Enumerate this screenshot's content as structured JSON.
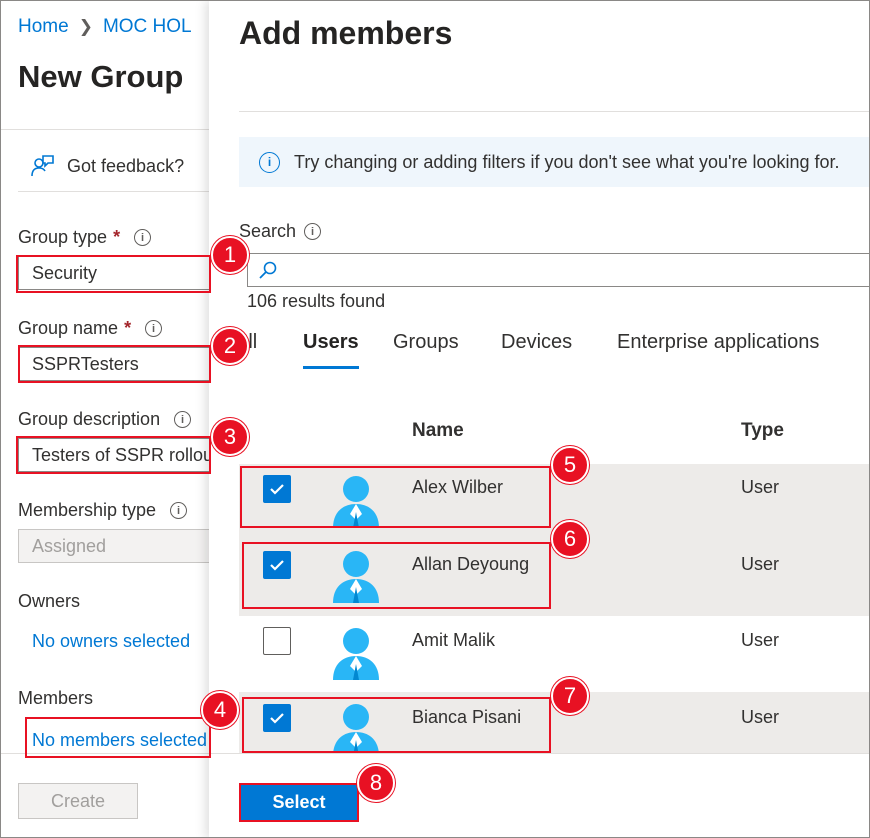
{
  "left_panel": {
    "breadcrumb": [
      "Home",
      "MOC HOL"
    ],
    "title": "New Group",
    "feedback": "Got feedback?",
    "group_type_label": "Group type",
    "group_type_value": "Security",
    "group_name_label": "Group name",
    "group_name_value": "SSPRTesters",
    "group_description_label": "Group description",
    "group_description_value": "Testers of SSPR rollout",
    "membership_type_label": "Membership type",
    "membership_type_value": "Assigned",
    "owners_label": "Owners",
    "owners_link": "No owners selected",
    "members_label": "Members",
    "members_link": "No members selected",
    "create_button": "Create"
  },
  "add_members": {
    "title": "Add members",
    "info_banner": "Try changing or adding filters if you don't see what you're looking for.",
    "search_label": "Search",
    "search_value": "",
    "results": "106 results found",
    "tabs": [
      "All",
      "Users",
      "Groups",
      "Devices",
      "Enterprise applications"
    ],
    "active_tab": "Users",
    "columns": [
      "Name",
      "Type"
    ],
    "rows": [
      {
        "name": "Alex Wilber",
        "type": "User",
        "checked": true
      },
      {
        "name": "Allan Deyoung",
        "type": "User",
        "checked": true
      },
      {
        "name": "Amit Malik",
        "type": "User",
        "checked": false
      },
      {
        "name": "Bianca Pisani",
        "type": "User",
        "checked": true
      }
    ],
    "select_button": "Select"
  },
  "annotations": [
    "1",
    "2",
    "3",
    "4",
    "5",
    "6",
    "7",
    "8"
  ],
  "colors": {
    "accent": "#0078d4",
    "annotation": "#e81123",
    "avatar": "#29b6f6"
  }
}
